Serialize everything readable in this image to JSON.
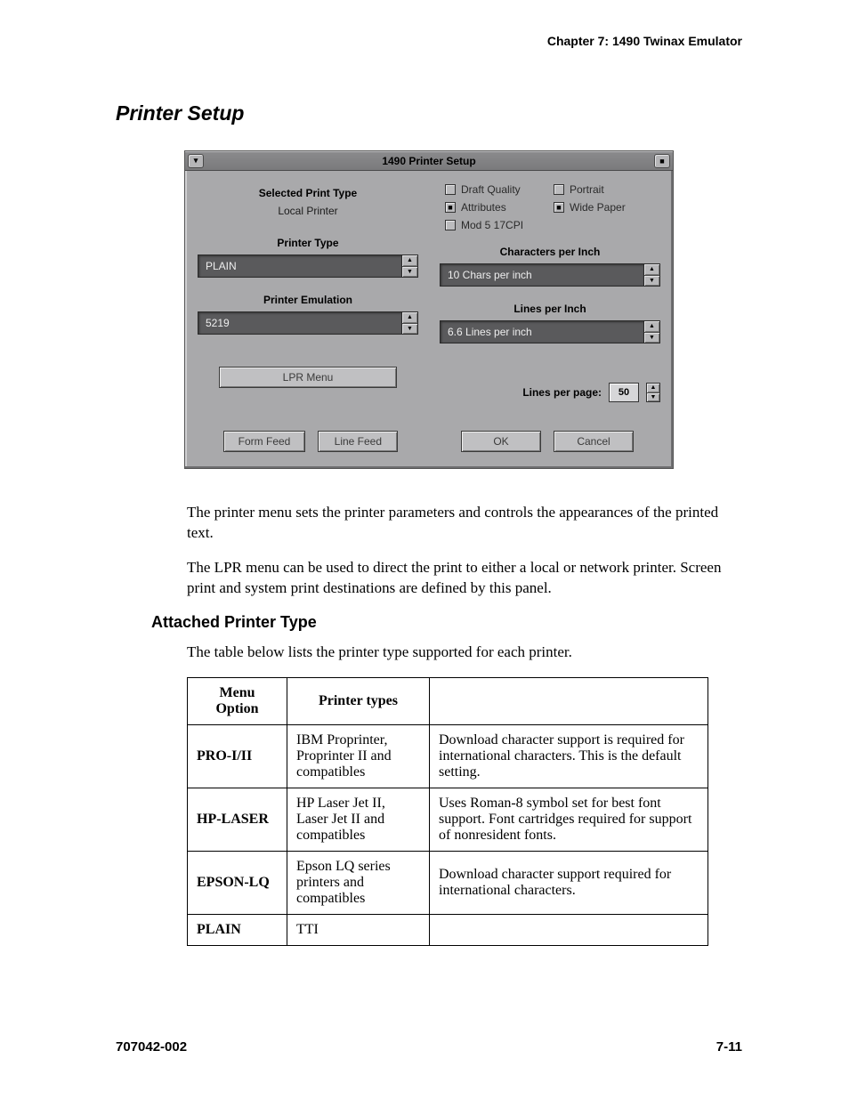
{
  "header": {
    "chapter": "Chapter 7: 1490 Twinax Emulator"
  },
  "section": {
    "title": "Printer Setup"
  },
  "dialog": {
    "title": "1490 Printer Setup",
    "left": {
      "selected_print_type_label": "Selected Print Type",
      "selected_print_type_value": "Local Printer",
      "printer_type_label": "Printer Type",
      "printer_type_value": "PLAIN",
      "printer_emulation_label": "Printer Emulation",
      "printer_emulation_value": "5219",
      "lpr_menu": "LPR Menu"
    },
    "right": {
      "checks": [
        {
          "label": "Draft Quality",
          "checked": false
        },
        {
          "label": "Portrait",
          "checked": false
        },
        {
          "label": "Attributes",
          "checked": true
        },
        {
          "label": "Wide Paper",
          "checked": true
        },
        {
          "label": "Mod 5 17CPI",
          "checked": false
        }
      ],
      "cpi_label": "Characters per Inch",
      "cpi_value": "10 Chars per inch",
      "lpi_label": "Lines per Inch",
      "lpi_value": "6.6 Lines per inch",
      "lpp_label": "Lines per page:",
      "lpp_value": "50"
    },
    "buttons": {
      "form_feed": "Form Feed",
      "line_feed": "Line Feed",
      "ok": "OK",
      "cancel": "Cancel"
    }
  },
  "para1": "The printer menu sets the printer parameters and controls the appearances of the printed text.",
  "para2": "The LPR menu can be used to direct the print to either a local or network printer. Screen print and system print destinations are defined by this panel.",
  "subheading": "Attached Printer Type",
  "para3": "The table below lists the printer type supported for each printer.",
  "table": {
    "headers": [
      "Menu Option",
      "Printer types",
      ""
    ],
    "rows": [
      {
        "opt": "PRO-I/II",
        "types": "IBM Proprinter, Proprinter II and compatibles",
        "desc": "Download character support is required for international characters.  This is the default setting."
      },
      {
        "opt": "HP-LASER",
        "types": "HP Laser Jet II, Laser Jet II and compatibles",
        "desc": "Uses Roman-8 symbol set for best font support.  Font cartridges required for support of nonresident fonts."
      },
      {
        "opt": "EPSON-LQ",
        "types": "Epson LQ series printers and compatibles",
        "desc": "Download character support required for international characters."
      },
      {
        "opt": "PLAIN",
        "types": "TTI",
        "desc": ""
      }
    ]
  },
  "footer": {
    "doc": "707042-002",
    "page": "7-11"
  }
}
